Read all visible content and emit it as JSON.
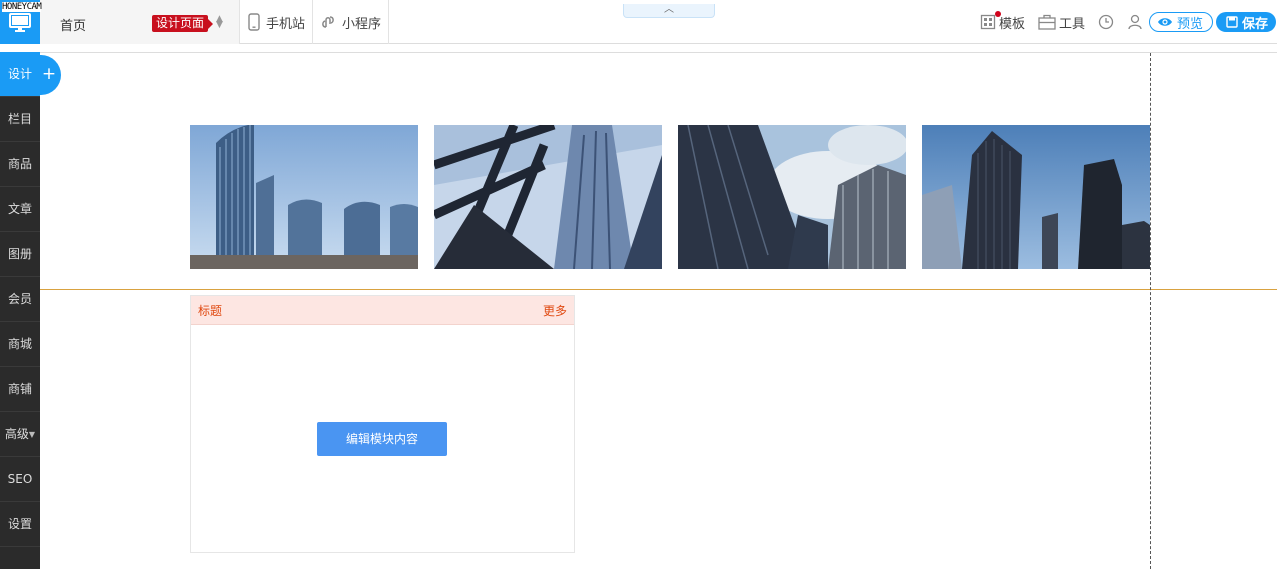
{
  "watermark": "HONEYCAM",
  "header": {
    "page_name": "首页",
    "design_badge": "设计页面",
    "mobile_site": "手机站",
    "mini_program": "小程序",
    "template": "模板",
    "tools": "工具",
    "preview": "预览",
    "save": "保存"
  },
  "sidebar": {
    "items": [
      {
        "label": "设计",
        "active": true
      },
      {
        "label": "栏目"
      },
      {
        "label": "商品"
      },
      {
        "label": "文章"
      },
      {
        "label": "图册"
      },
      {
        "label": "会员"
      },
      {
        "label": "商城"
      },
      {
        "label": "商铺"
      },
      {
        "label": "高级"
      },
      {
        "label": "SEO"
      },
      {
        "label": "设置"
      }
    ],
    "add_icon": "plus-icon"
  },
  "gallery": {
    "images": [
      "skyscraper-photo-1",
      "skyscraper-photo-2",
      "skyscraper-photo-3",
      "skyscraper-photo-4"
    ]
  },
  "module": {
    "title": "标题",
    "more": "更多",
    "edit_button": "编辑模块内容"
  },
  "colors": {
    "accent": "#1a9bf5",
    "badge": "#c8101e",
    "module_header_bg": "#fde6e2",
    "module_header_text": "#e04a12",
    "edit_button": "#4a95f2"
  }
}
